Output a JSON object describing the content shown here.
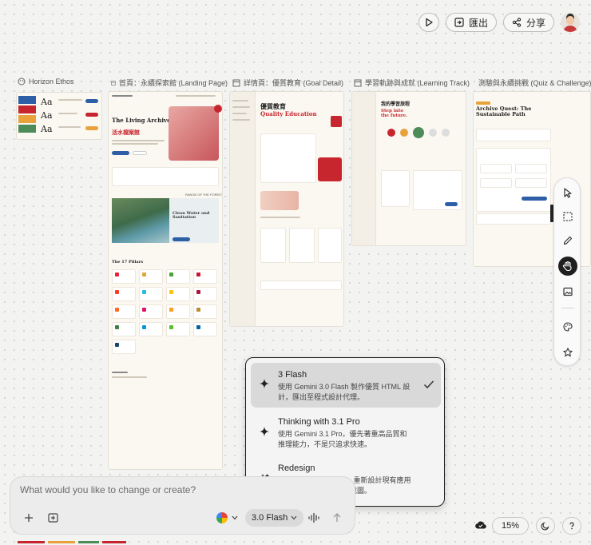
{
  "toolbar": {
    "export_label": "匯出",
    "share_label": "分享"
  },
  "frames": {
    "ethos": {
      "title": "Horizon Ethos"
    },
    "landing": {
      "title": "首頁：永續探索館 (Landing Page)",
      "hero_title": "The Living Archive",
      "hero_title_zh": "活水檔案館",
      "section_title": "Clean Water and Sanitation",
      "pillars_title": "The 17 Pillars"
    },
    "goal": {
      "title": "詳情頁：優質教育 (Goal Detail)",
      "hero_zh": "優質教育",
      "hero_en": "Quality Education"
    },
    "track": {
      "title": "學習軌跡與成就 (Learning Track)",
      "hero_zh": "我的學習旅程",
      "hero_en": "Step into the future."
    },
    "quiz": {
      "title": "測驗與永續挑戰 (Quiz & Challenge)",
      "hero": "Archive Quest: The Sustainable Path"
    }
  },
  "prompt": {
    "placeholder": "What would you like to change or create?",
    "model_label": "3.0 Flash"
  },
  "model_menu": {
    "items": [
      {
        "title": "3 Flash",
        "desc": "使用 Gemini 3.0 Flash 製作優質 HTML 設計，匯出至程式設計代理。",
        "selected": true
      },
      {
        "title": "Thinking with 3.1 Pro",
        "desc": "使用 Gemini 3.1 Pro，優先著重高品質和推理能力，不是只追求快速。",
        "selected": false
      },
      {
        "title": "Redesign",
        "desc": "運用 Nano Banana Pro 重新設計現有應用程式或網站。附加螢幕截圖。",
        "selected": false
      }
    ]
  },
  "zoom": "15%",
  "colors": {
    "accent_red": "#c8262f",
    "accent_blue": "#2d5fa6",
    "cream": "#fbf8f1"
  }
}
